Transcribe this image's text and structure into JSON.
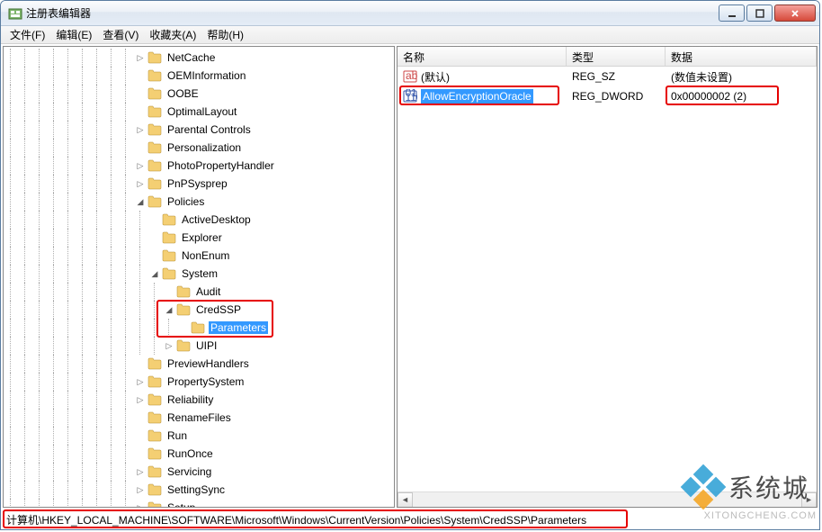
{
  "window": {
    "title": "注册表编辑器"
  },
  "menu": {
    "file": "文件(F)",
    "edit": "编辑(E)",
    "view": "查看(V)",
    "favorites": "收藏夹(A)",
    "help": "帮助(H)"
  },
  "tree": {
    "items": [
      {
        "name": "NetCache",
        "depth": 9,
        "exp": "collapsed"
      },
      {
        "name": "OEMInformation",
        "depth": 9,
        "exp": "none"
      },
      {
        "name": "OOBE",
        "depth": 9,
        "exp": "none"
      },
      {
        "name": "OptimalLayout",
        "depth": 9,
        "exp": "none"
      },
      {
        "name": "Parental Controls",
        "depth": 9,
        "exp": "collapsed"
      },
      {
        "name": "Personalization",
        "depth": 9,
        "exp": "none"
      },
      {
        "name": "PhotoPropertyHandler",
        "depth": 9,
        "exp": "collapsed"
      },
      {
        "name": "PnPSysprep",
        "depth": 9,
        "exp": "collapsed"
      },
      {
        "name": "Policies",
        "depth": 9,
        "exp": "expanded"
      },
      {
        "name": "ActiveDesktop",
        "depth": 10,
        "exp": "none"
      },
      {
        "name": "Explorer",
        "depth": 10,
        "exp": "none"
      },
      {
        "name": "NonEnum",
        "depth": 10,
        "exp": "none"
      },
      {
        "name": "System",
        "depth": 10,
        "exp": "expanded"
      },
      {
        "name": "Audit",
        "depth": 11,
        "exp": "none"
      },
      {
        "name": "CredSSP",
        "depth": 11,
        "exp": "expanded",
        "hl": true
      },
      {
        "name": "Parameters",
        "depth": 12,
        "exp": "none",
        "selected": true,
        "hl": true
      },
      {
        "name": "UIPI",
        "depth": 11,
        "exp": "collapsed"
      },
      {
        "name": "PreviewHandlers",
        "depth": 9,
        "exp": "none"
      },
      {
        "name": "PropertySystem",
        "depth": 9,
        "exp": "collapsed"
      },
      {
        "name": "Reliability",
        "depth": 9,
        "exp": "collapsed"
      },
      {
        "name": "RenameFiles",
        "depth": 9,
        "exp": "none"
      },
      {
        "name": "Run",
        "depth": 9,
        "exp": "none"
      },
      {
        "name": "RunOnce",
        "depth": 9,
        "exp": "none"
      },
      {
        "name": "Servicing",
        "depth": 9,
        "exp": "collapsed"
      },
      {
        "name": "SettingSync",
        "depth": 9,
        "exp": "collapsed"
      },
      {
        "name": "Setup",
        "depth": 9,
        "exp": "collapsed"
      }
    ]
  },
  "list": {
    "headers": {
      "name": "名称",
      "type": "类型",
      "data": "数据"
    },
    "col_widths": {
      "name": 188,
      "type": 110,
      "data": 168
    },
    "rows": [
      {
        "icon": "reg-sz",
        "name": "(默认)",
        "type": "REG_SZ",
        "data": "(数值未设置)"
      },
      {
        "icon": "reg-dword",
        "name": "AllowEncryptionOracle",
        "type": "REG_DWORD",
        "data": "0x00000002 (2)",
        "selected": true,
        "hl_name": true,
        "hl_data": true
      }
    ]
  },
  "statusbar": {
    "path": "计算机\\HKEY_LOCAL_MACHINE\\SOFTWARE\\Microsoft\\Windows\\CurrentVersion\\Policies\\System\\CredSSP\\Parameters"
  },
  "watermark": {
    "text": "系统城",
    "url": "XITONGCHENG.COM"
  }
}
